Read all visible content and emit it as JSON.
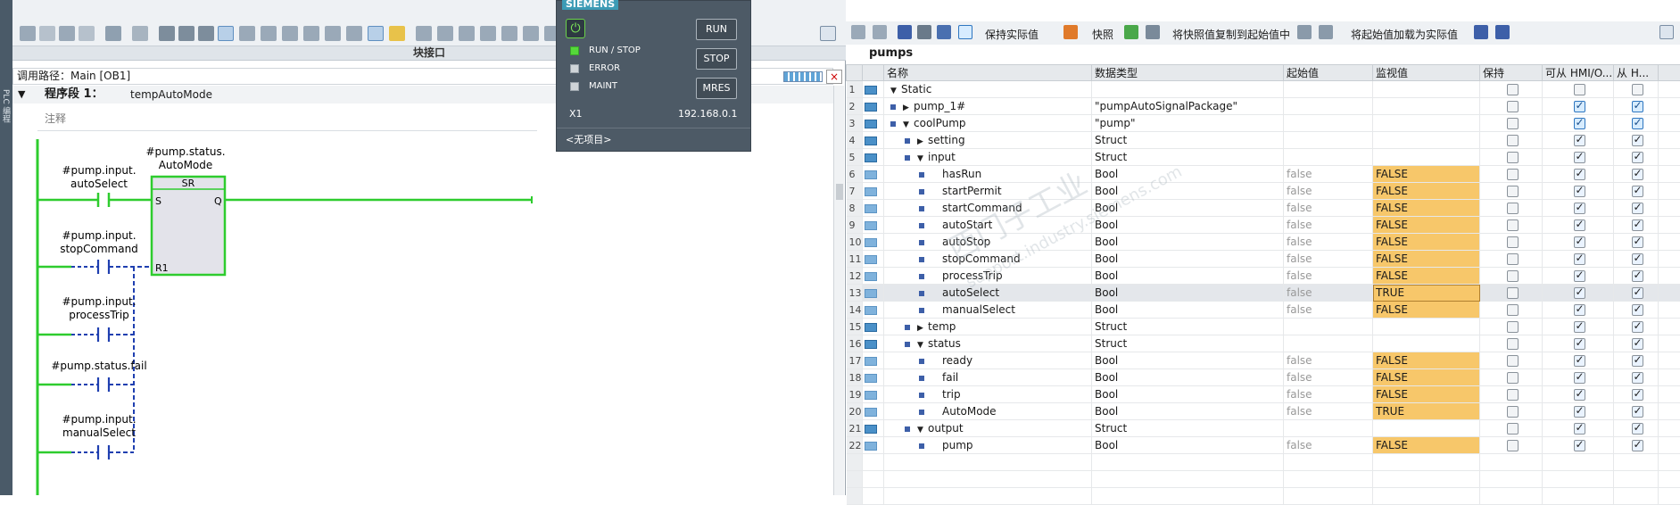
{
  "left": {
    "sidebar_tab": "PLC 编程",
    "block_interface_label": "块接口",
    "call_path": "调用路径：Main [OB1]",
    "network": {
      "title": "程序段 1：",
      "name": "tempAutoMode",
      "comment": "注释"
    },
    "ladder": {
      "coil_operand": "#pump.status.\nAutoMode",
      "coil_operand_l1": "#pump.status.",
      "coil_operand_l2": "AutoMode",
      "sr_label": "SR",
      "sr_s": "S",
      "sr_q": "Q",
      "sr_r1": "R1",
      "contacts": [
        {
          "l1": "#pump.input.",
          "l2": "autoSelect"
        },
        {
          "l1": "#pump.input.",
          "l2": "stopCommand"
        },
        {
          "l1": "#pump.input.",
          "l2": "processTrip"
        },
        {
          "l1": "#pump.status.fail",
          "l2": ""
        },
        {
          "l1": "#pump.input.",
          "l2": "manualSelect"
        }
      ]
    }
  },
  "plc_panel": {
    "brand": "SIEMENS",
    "leds": [
      {
        "label": "RUN / STOP",
        "on": true
      },
      {
        "label": "ERROR",
        "on": false
      },
      {
        "label": "MAINT",
        "on": false
      }
    ],
    "buttons": [
      "RUN",
      "STOP",
      "MRES"
    ],
    "interface": "X1",
    "ip": "192.168.0.1",
    "project": "<无项目>"
  },
  "right": {
    "toolbar": {
      "keep_actual": "保持实际值",
      "snapshot": "快照",
      "copy_snapshot": "将快照值复制到起始值中",
      "load_start": "将起始值加载为实际值"
    },
    "db_title": "pumps",
    "columns": [
      "名称",
      "数据类型",
      "起始值",
      "监视值",
      "保持",
      "可从 HMI/O...",
      "从 H..."
    ],
    "rows": [
      {
        "n": "1",
        "name": "Static",
        "type": "",
        "start": "",
        "mon": "",
        "depth": 0,
        "expand": "down",
        "sq": false
      },
      {
        "n": "2",
        "name": "pump_1#",
        "type": "\"pumpAutoSignalPackage\"",
        "start": "",
        "mon": "",
        "depth": 1,
        "expand": "right",
        "sq": true
      },
      {
        "n": "3",
        "name": "coolPump",
        "type": "\"pump\"",
        "start": "",
        "mon": "",
        "depth": 1,
        "expand": "down",
        "sq": true
      },
      {
        "n": "4",
        "name": "setting",
        "type": "Struct",
        "start": "",
        "mon": "",
        "depth": 2,
        "expand": "right",
        "sq": true
      },
      {
        "n": "5",
        "name": "input",
        "type": "Struct",
        "start": "",
        "mon": "",
        "depth": 2,
        "expand": "down",
        "sq": true
      },
      {
        "n": "6",
        "name": "hasRun",
        "type": "Bool",
        "start": "false",
        "mon": "FALSE",
        "depth": 3,
        "expand": "",
        "sq": true
      },
      {
        "n": "7",
        "name": "startPermit",
        "type": "Bool",
        "start": "false",
        "mon": "FALSE",
        "depth": 3,
        "expand": "",
        "sq": true
      },
      {
        "n": "8",
        "name": "startCommand",
        "type": "Bool",
        "start": "false",
        "mon": "FALSE",
        "depth": 3,
        "expand": "",
        "sq": true
      },
      {
        "n": "9",
        "name": "autoStart",
        "type": "Bool",
        "start": "false",
        "mon": "FALSE",
        "depth": 3,
        "expand": "",
        "sq": true
      },
      {
        "n": "10",
        "name": "autoStop",
        "type": "Bool",
        "start": "false",
        "mon": "FALSE",
        "depth": 3,
        "expand": "",
        "sq": true
      },
      {
        "n": "11",
        "name": "stopCommand",
        "type": "Bool",
        "start": "false",
        "mon": "FALSE",
        "depth": 3,
        "expand": "",
        "sq": true
      },
      {
        "n": "12",
        "name": "processTrip",
        "type": "Bool",
        "start": "false",
        "mon": "FALSE",
        "depth": 3,
        "expand": "",
        "sq": true
      },
      {
        "n": "13",
        "name": "autoSelect",
        "type": "Bool",
        "start": "false",
        "mon": "TRUE",
        "depth": 3,
        "expand": "",
        "sq": true
      },
      {
        "n": "14",
        "name": "manualSelect",
        "type": "Bool",
        "start": "false",
        "mon": "FALSE",
        "depth": 3,
        "expand": "",
        "sq": true
      },
      {
        "n": "15",
        "name": "temp",
        "type": "Struct",
        "start": "",
        "mon": "",
        "depth": 2,
        "expand": "right",
        "sq": true
      },
      {
        "n": "16",
        "name": "status",
        "type": "Struct",
        "start": "",
        "mon": "",
        "depth": 2,
        "expand": "down",
        "sq": true
      },
      {
        "n": "17",
        "name": "ready",
        "type": "Bool",
        "start": "false",
        "mon": "FALSE",
        "depth": 3,
        "expand": "",
        "sq": true
      },
      {
        "n": "18",
        "name": "fail",
        "type": "Bool",
        "start": "false",
        "mon": "FALSE",
        "depth": 3,
        "expand": "",
        "sq": true
      },
      {
        "n": "19",
        "name": "trip",
        "type": "Bool",
        "start": "false",
        "mon": "FALSE",
        "depth": 3,
        "expand": "",
        "sq": true
      },
      {
        "n": "20",
        "name": "AutoMode",
        "type": "Bool",
        "start": "false",
        "mon": "TRUE",
        "depth": 3,
        "expand": "",
        "sq": true
      },
      {
        "n": "21",
        "name": "output",
        "type": "Struct",
        "start": "",
        "mon": "",
        "depth": 2,
        "expand": "down",
        "sq": true
      },
      {
        "n": "22",
        "name": "pump",
        "type": "Bool",
        "start": "false",
        "mon": "FALSE",
        "depth": 3,
        "expand": "",
        "sq": true
      }
    ]
  },
  "watermark": {
    "line1": "西门子工业",
    "line2": "support.industry.siemens.com"
  }
}
